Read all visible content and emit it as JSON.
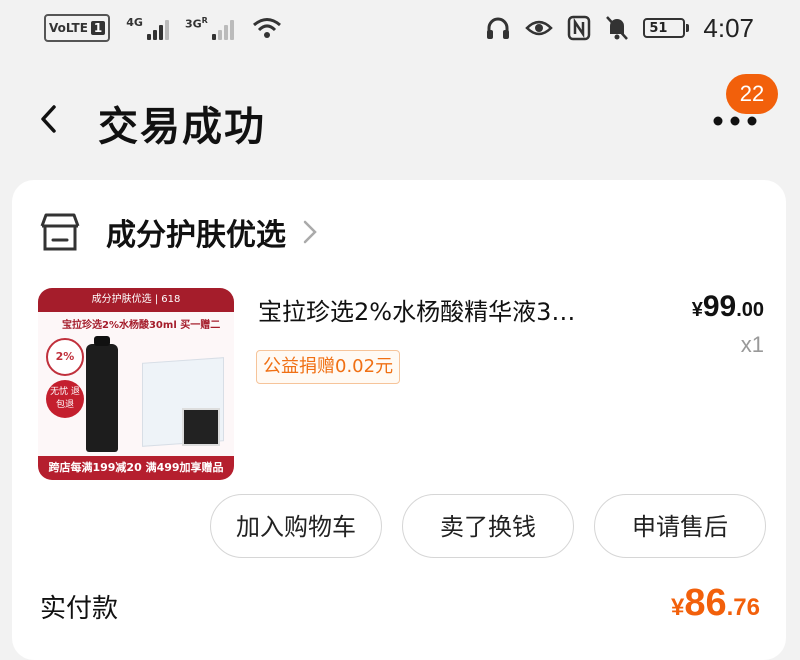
{
  "status_bar": {
    "volte": "VoLTE",
    "sim1": "1",
    "net1": "4G",
    "net2": "3G",
    "net2_suffix": "R",
    "battery": "51",
    "time": "4:07"
  },
  "header": {
    "title": "交易成功",
    "notification_count": "22",
    "icons": {
      "back": "chevron-left-icon",
      "more": "more-dots-icon"
    }
  },
  "shop": {
    "name": "成分护肤优选",
    "icon": "store-icon"
  },
  "product": {
    "name": "宝拉珍选2%水杨酸精华液3…",
    "price_symbol": "¥",
    "price_int": "99",
    "price_dec": ".00",
    "quantity": "x1",
    "tag": "公益捐赠0.02元",
    "image": {
      "top_banner": "成分护肤优选 | 618",
      "line2": "宝拉珍选2%水杨酸30ml 买一赠二",
      "circle": "2%",
      "red_badge": "无忧 退包退",
      "bottom_banner": "跨店每满199减20 满499加享赠品"
    }
  },
  "actions": {
    "add_to_cart": "加入购物车",
    "resell": "卖了换钱",
    "after_sales": "申请售后"
  },
  "payment": {
    "label": "实付款",
    "symbol": "¥",
    "int": "86",
    "dec": ".76"
  },
  "colors": {
    "accent": "#f2600b",
    "tag_text": "#f07014",
    "background": "#f2f2f2"
  }
}
